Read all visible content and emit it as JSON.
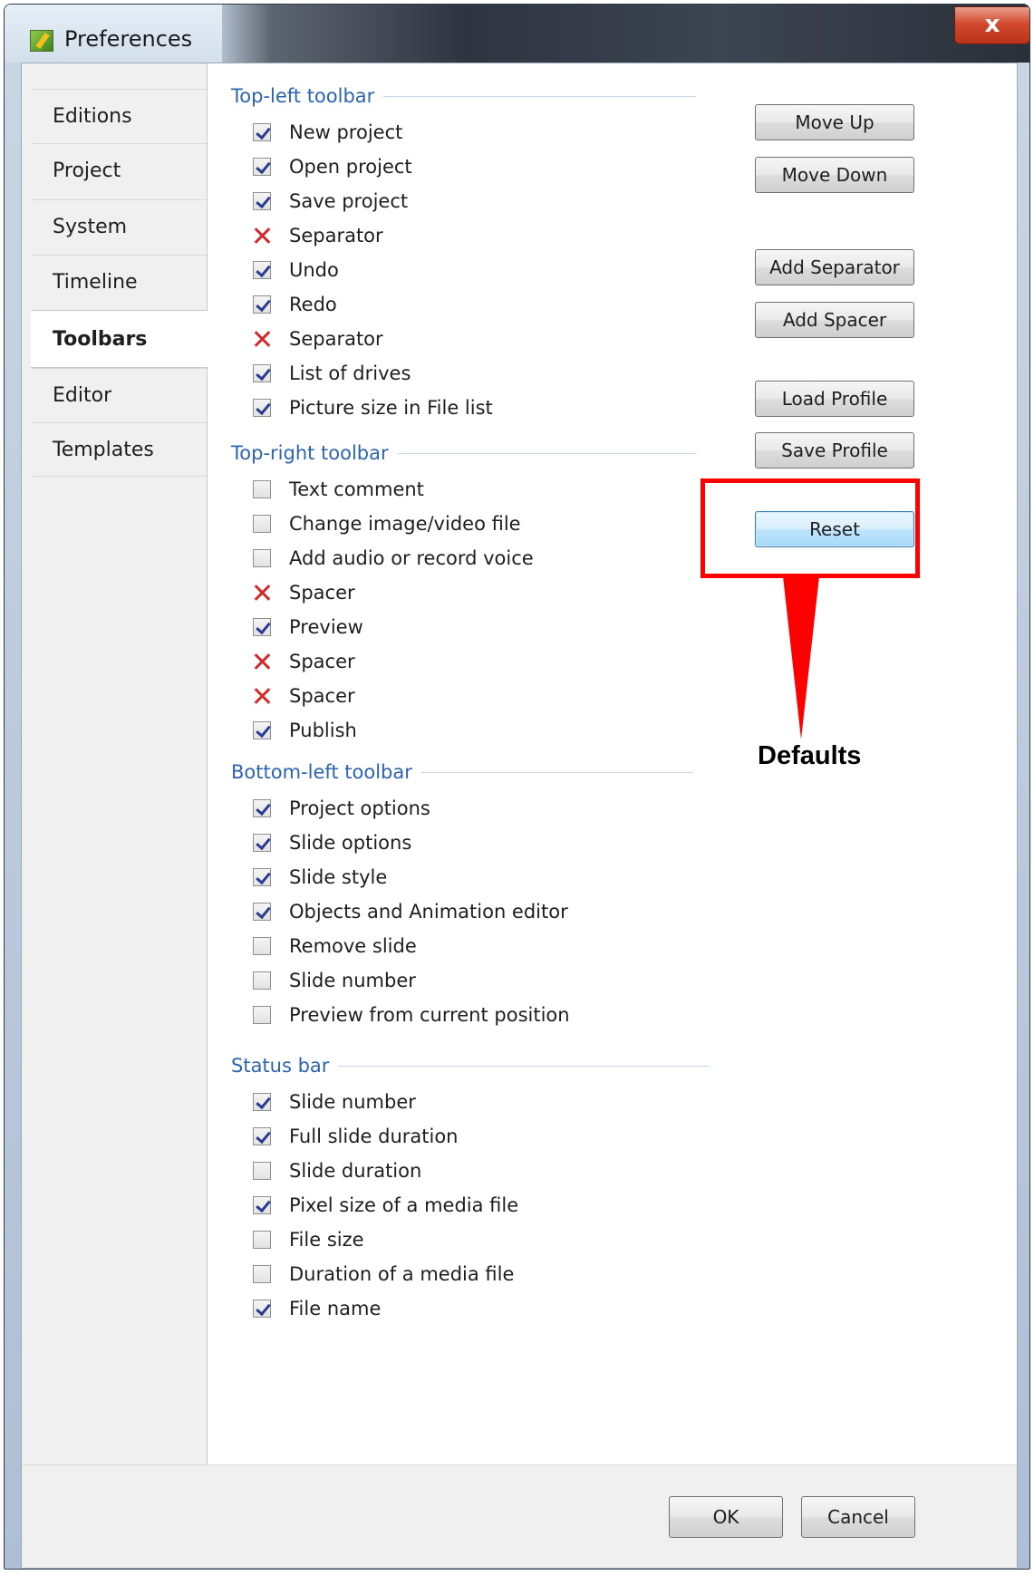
{
  "window": {
    "title": "Preferences",
    "close_label": "x"
  },
  "sidebar": {
    "items": [
      {
        "label": "Editions"
      },
      {
        "label": "Project"
      },
      {
        "label": "System"
      },
      {
        "label": "Timeline"
      },
      {
        "label": "Toolbars"
      },
      {
        "label": "Editor"
      },
      {
        "label": "Templates"
      }
    ],
    "active": "Toolbars"
  },
  "groups": [
    {
      "title": "Top-left toolbar",
      "items": [
        {
          "label": "New project",
          "state": "checked"
        },
        {
          "label": "Open project",
          "state": "checked"
        },
        {
          "label": "Save project",
          "state": "checked"
        },
        {
          "label": "Separator",
          "state": "x"
        },
        {
          "label": "Undo",
          "state": "checked"
        },
        {
          "label": "Redo",
          "state": "checked"
        },
        {
          "label": "Separator",
          "state": "x"
        },
        {
          "label": "List of drives",
          "state": "checked"
        },
        {
          "label": "Picture size in File list",
          "state": "checked"
        }
      ]
    },
    {
      "title": "Top-right toolbar",
      "items": [
        {
          "label": "Text comment",
          "state": "unchecked"
        },
        {
          "label": "Change image/video file",
          "state": "unchecked"
        },
        {
          "label": "Add audio or record voice",
          "state": "unchecked"
        },
        {
          "label": "Spacer",
          "state": "x"
        },
        {
          "label": "Preview",
          "state": "checked"
        },
        {
          "label": "Spacer",
          "state": "x"
        },
        {
          "label": "Spacer",
          "state": "x"
        },
        {
          "label": "Publish",
          "state": "checked"
        }
      ]
    },
    {
      "title": "Bottom-left toolbar",
      "items": [
        {
          "label": "Project options",
          "state": "checked"
        },
        {
          "label": "Slide options",
          "state": "checked"
        },
        {
          "label": "Slide style",
          "state": "checked"
        },
        {
          "label": "Objects and Animation editor",
          "state": "checked"
        },
        {
          "label": "Remove slide",
          "state": "unchecked"
        },
        {
          "label": "Slide number",
          "state": "unchecked"
        },
        {
          "label": "Preview from current position",
          "state": "unchecked"
        }
      ]
    },
    {
      "title": "Status bar",
      "items": [
        {
          "label": "Slide number",
          "state": "checked"
        },
        {
          "label": "Full slide duration",
          "state": "checked"
        },
        {
          "label": "Slide duration",
          "state": "unchecked"
        },
        {
          "label": "Pixel size of a media file",
          "state": "checked"
        },
        {
          "label": "File size",
          "state": "unchecked"
        },
        {
          "label": "Duration of a media file",
          "state": "unchecked"
        },
        {
          "label": "File name",
          "state": "checked"
        }
      ]
    }
  ],
  "buttons": {
    "move_up": "Move Up",
    "move_down": "Move Down",
    "add_separator": "Add Separator",
    "add_spacer": "Add Spacer",
    "load_profile": "Load Profile",
    "save_profile": "Save Profile",
    "reset": "Reset"
  },
  "footer": {
    "ok": "OK",
    "cancel": "Cancel"
  },
  "annotation": {
    "text": "Defaults",
    "color": "#ff0000"
  }
}
